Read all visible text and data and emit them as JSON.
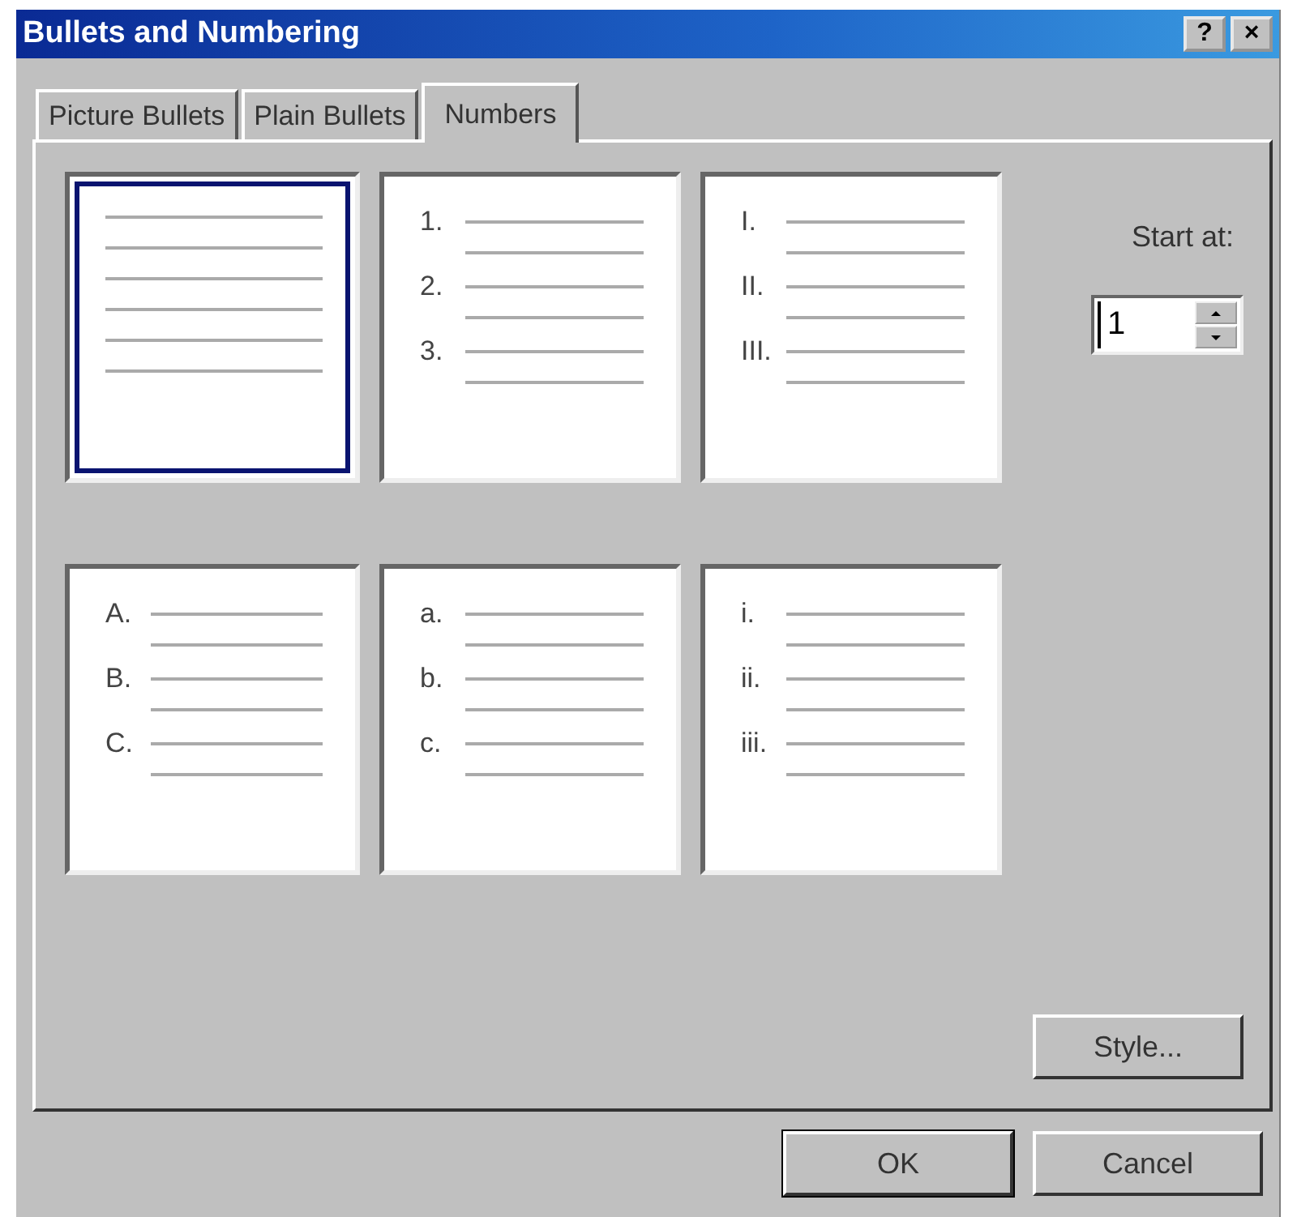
{
  "window": {
    "title": "Bullets and Numbering",
    "help_button": "?",
    "close_button": "×"
  },
  "tabs": [
    {
      "label": "Picture Bullets",
      "selected": false
    },
    {
      "label": "Plain Bullets",
      "selected": false
    },
    {
      "label": "Numbers",
      "selected": true
    }
  ],
  "styles": [
    {
      "kind": "none",
      "selected": true
    },
    {
      "kind": "numbered",
      "markers": [
        "1.",
        "2.",
        "3."
      ],
      "selected": false
    },
    {
      "kind": "numbered",
      "markers": [
        "I.",
        "II.",
        "III."
      ],
      "selected": false
    },
    {
      "kind": "numbered",
      "markers": [
        "A.",
        "B.",
        "C."
      ],
      "selected": false
    },
    {
      "kind": "numbered",
      "markers": [
        "a.",
        "b.",
        "c."
      ],
      "selected": false
    },
    {
      "kind": "numbered",
      "markers": [
        "i.",
        "ii.",
        "iii."
      ],
      "selected": false
    }
  ],
  "start_at": {
    "label": "Start at:",
    "value": "1"
  },
  "style_button": "Style...",
  "buttons": [
    "OK",
    "Cancel"
  ]
}
